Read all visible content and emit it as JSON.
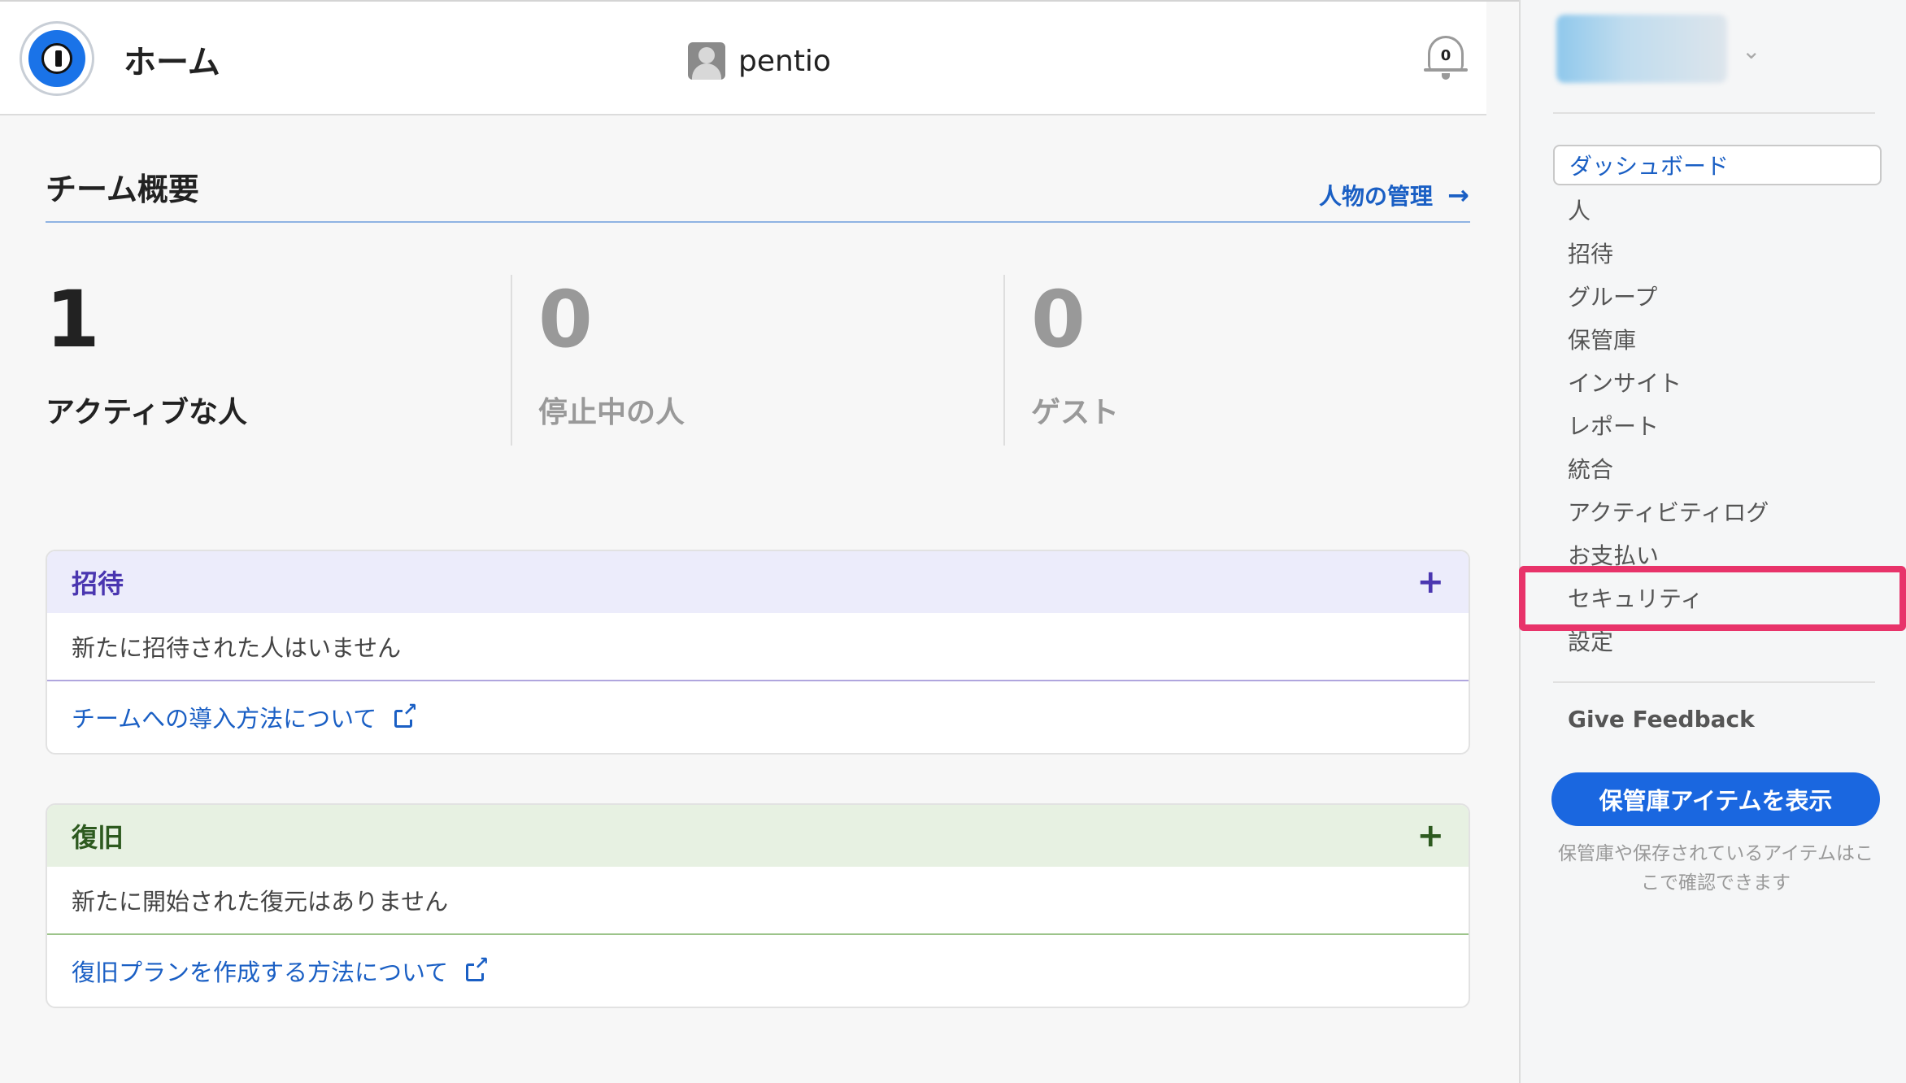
{
  "header": {
    "title": "ホーム",
    "account_name": "pentio",
    "notification_count": "0"
  },
  "overview": {
    "title": "チーム概要",
    "manage_link": "人物の管理",
    "stats": [
      {
        "value": "1",
        "label": "アクティブな人"
      },
      {
        "value": "0",
        "label": "停止中の人"
      },
      {
        "value": "0",
        "label": "ゲスト"
      }
    ]
  },
  "invite_card": {
    "title": "招待",
    "add": "+",
    "empty_text": "新たに招待された人はいません",
    "link": "チームへの導入方法について"
  },
  "recovery_card": {
    "title": "復旧",
    "add": "+",
    "empty_text": "新たに開始された復元はありません",
    "link": "復旧プランを作成する方法について"
  },
  "sidebar": {
    "chevron": "⌄",
    "items": [
      {
        "label": "ダッシュボード"
      },
      {
        "label": "人"
      },
      {
        "label": "招待"
      },
      {
        "label": "グループ"
      },
      {
        "label": "保管庫"
      },
      {
        "label": "インサイト"
      },
      {
        "label": "レポート"
      },
      {
        "label": "統合"
      },
      {
        "label": "アクティビティログ"
      },
      {
        "label": "お支払い"
      },
      {
        "label": "セキュリティ"
      },
      {
        "label": "設定"
      }
    ],
    "feedback": "Give Feedback",
    "vault_button": "保管庫アイテムを表示",
    "vault_note": "保管庫や保存されているアイテムはここで確認できます"
  },
  "colors": {
    "accent": "#1a67e0",
    "link": "#1a5fc4",
    "highlight": "#e8336a",
    "invite": "#4a36b0",
    "recovery": "#2d5a1f"
  }
}
